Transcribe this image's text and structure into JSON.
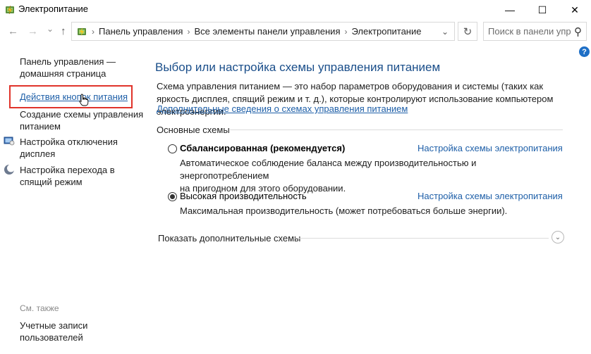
{
  "window": {
    "title": "Электропитание",
    "minimize": "—",
    "maximize": "☐",
    "close": "✕"
  },
  "nav": {
    "back": "←",
    "forward": "→",
    "recent": "⌄",
    "up": "↑",
    "breadcrumb": [
      "Панель управления",
      "Все элементы панели управления",
      "Электропитание"
    ],
    "separator": "›",
    "dropdown": "⌄",
    "refresh": "↻",
    "search_placeholder": "Поиск в панели упр...",
    "search_icon": "⚲"
  },
  "help": "?",
  "sidebar": {
    "home_line1": "Панель управления —",
    "home_line2": "домашняя страница",
    "power_buttons": "Действия кнопок питания",
    "create_plan_line1": "Создание схемы управления",
    "create_plan_line2": "питанием",
    "display_off_line1": "Настройка отключения",
    "display_off_line2": "дисплея",
    "sleep_line1": "Настройка перехода в",
    "sleep_line2": "спящий режим",
    "see_also": "См. также",
    "accounts_line1": "Учетные записи",
    "accounts_line2": "пользователей"
  },
  "main": {
    "title": "Выбор или настройка схемы управления питанием",
    "description": "Схема управления питанием — это набор параметров оборудования и системы (таких как яркость дисплея, спящий режим и т. д.), которые контролируют использование компьютером электроэнергии.",
    "more_info_link": "Дополнительные сведения о схемах управления питанием",
    "group_title": "Основные схемы",
    "plans": [
      {
        "name": "Сбалансированная (рекомендуется)",
        "link": "Настройка схемы электропитания",
        "desc_line1": "Автоматическое соблюдение баланса между производительностью и энергопотреблением",
        "desc_line2": "на пригодном для этого оборудовании.",
        "selected": false
      },
      {
        "name": "Высокая производительность",
        "link": "Настройка схемы электропитания",
        "desc_line1": "Максимальная производительность (может потребоваться больше энергии).",
        "desc_line2": "",
        "selected": true
      }
    ],
    "show_more": "Показать дополнительные схемы",
    "show_more_icon": "⌄"
  },
  "colors": {
    "link": "#1e5fa8",
    "heading": "#1a4e8a",
    "highlight_box": "#e0332a"
  }
}
